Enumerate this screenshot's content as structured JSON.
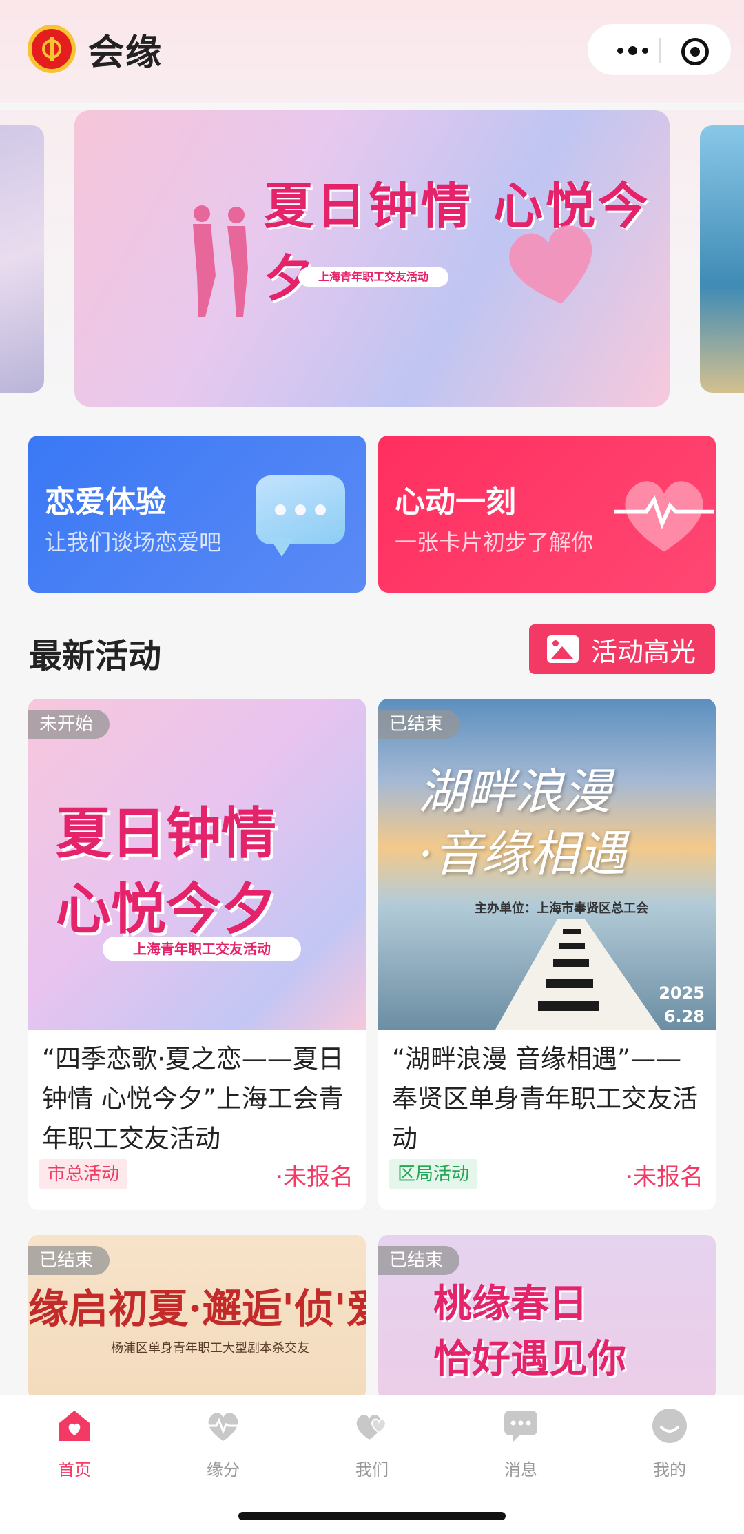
{
  "app": {
    "title": "会缘"
  },
  "capsule": {
    "more_icon": "more-dots-icon",
    "close_icon": "target-icon"
  },
  "banner": {
    "headline": "夏日钟情 心悦今夕",
    "pill": "上海青年职工交友活动"
  },
  "cta": {
    "love": {
      "title": "恋爱体验",
      "subtitle": "让我们谈场恋爱吧",
      "color": "#3a78f5"
    },
    "heartbeat": {
      "title": "心动一刻",
      "subtitle": "一张卡片初步了解你",
      "color": "#ff2f5f"
    }
  },
  "section": {
    "title": "最新活动",
    "highlight_button": "活动高光"
  },
  "cards": [
    {
      "status": "未开始",
      "thumb_title_line1": "夏日钟情",
      "thumb_title_line2": "心悦今夕",
      "thumb_pill": "上海青年职工交友活动",
      "title": "“四季恋歌·夏之恋——夏日钟情 心悦今夕”上海工会青年职工交友活动",
      "tag": "市总活动",
      "registration": "·未报名"
    },
    {
      "status": "已结束",
      "thumb_title_line1": "湖畔浪漫",
      "thumb_title_line2": "·音缘相遇",
      "thumb_host": "主办单位：上海市奉贤区总工会",
      "thumb_date_year": "2025",
      "thumb_date_day": "6.28",
      "title": "“湖畔浪漫 音缘相遇”——奉贤区单身青年职工交友活动",
      "tag": "区局活动",
      "registration": "·未报名"
    },
    {
      "status": "已结束",
      "thumb_title": "缘启初夏·邂逅'侦'爱",
      "thumb_sub": "杨浦区单身青年职工大型剧本杀交友"
    },
    {
      "status": "已结束",
      "thumb_title_line1": "桃缘春日",
      "thumb_title_line2": "恰好遇见你"
    }
  ],
  "tabs": [
    {
      "label": "首页",
      "icon": "home-icon",
      "active": true
    },
    {
      "label": "缘分",
      "icon": "heartbeat-icon",
      "active": false
    },
    {
      "label": "我们",
      "icon": "hearts-icon",
      "active": false
    },
    {
      "label": "消息",
      "icon": "message-icon",
      "active": false
    },
    {
      "label": "我的",
      "icon": "profile-icon",
      "active": false
    }
  ],
  "colors": {
    "accent": "#f23a65",
    "inactive": "#c8c8c8"
  }
}
